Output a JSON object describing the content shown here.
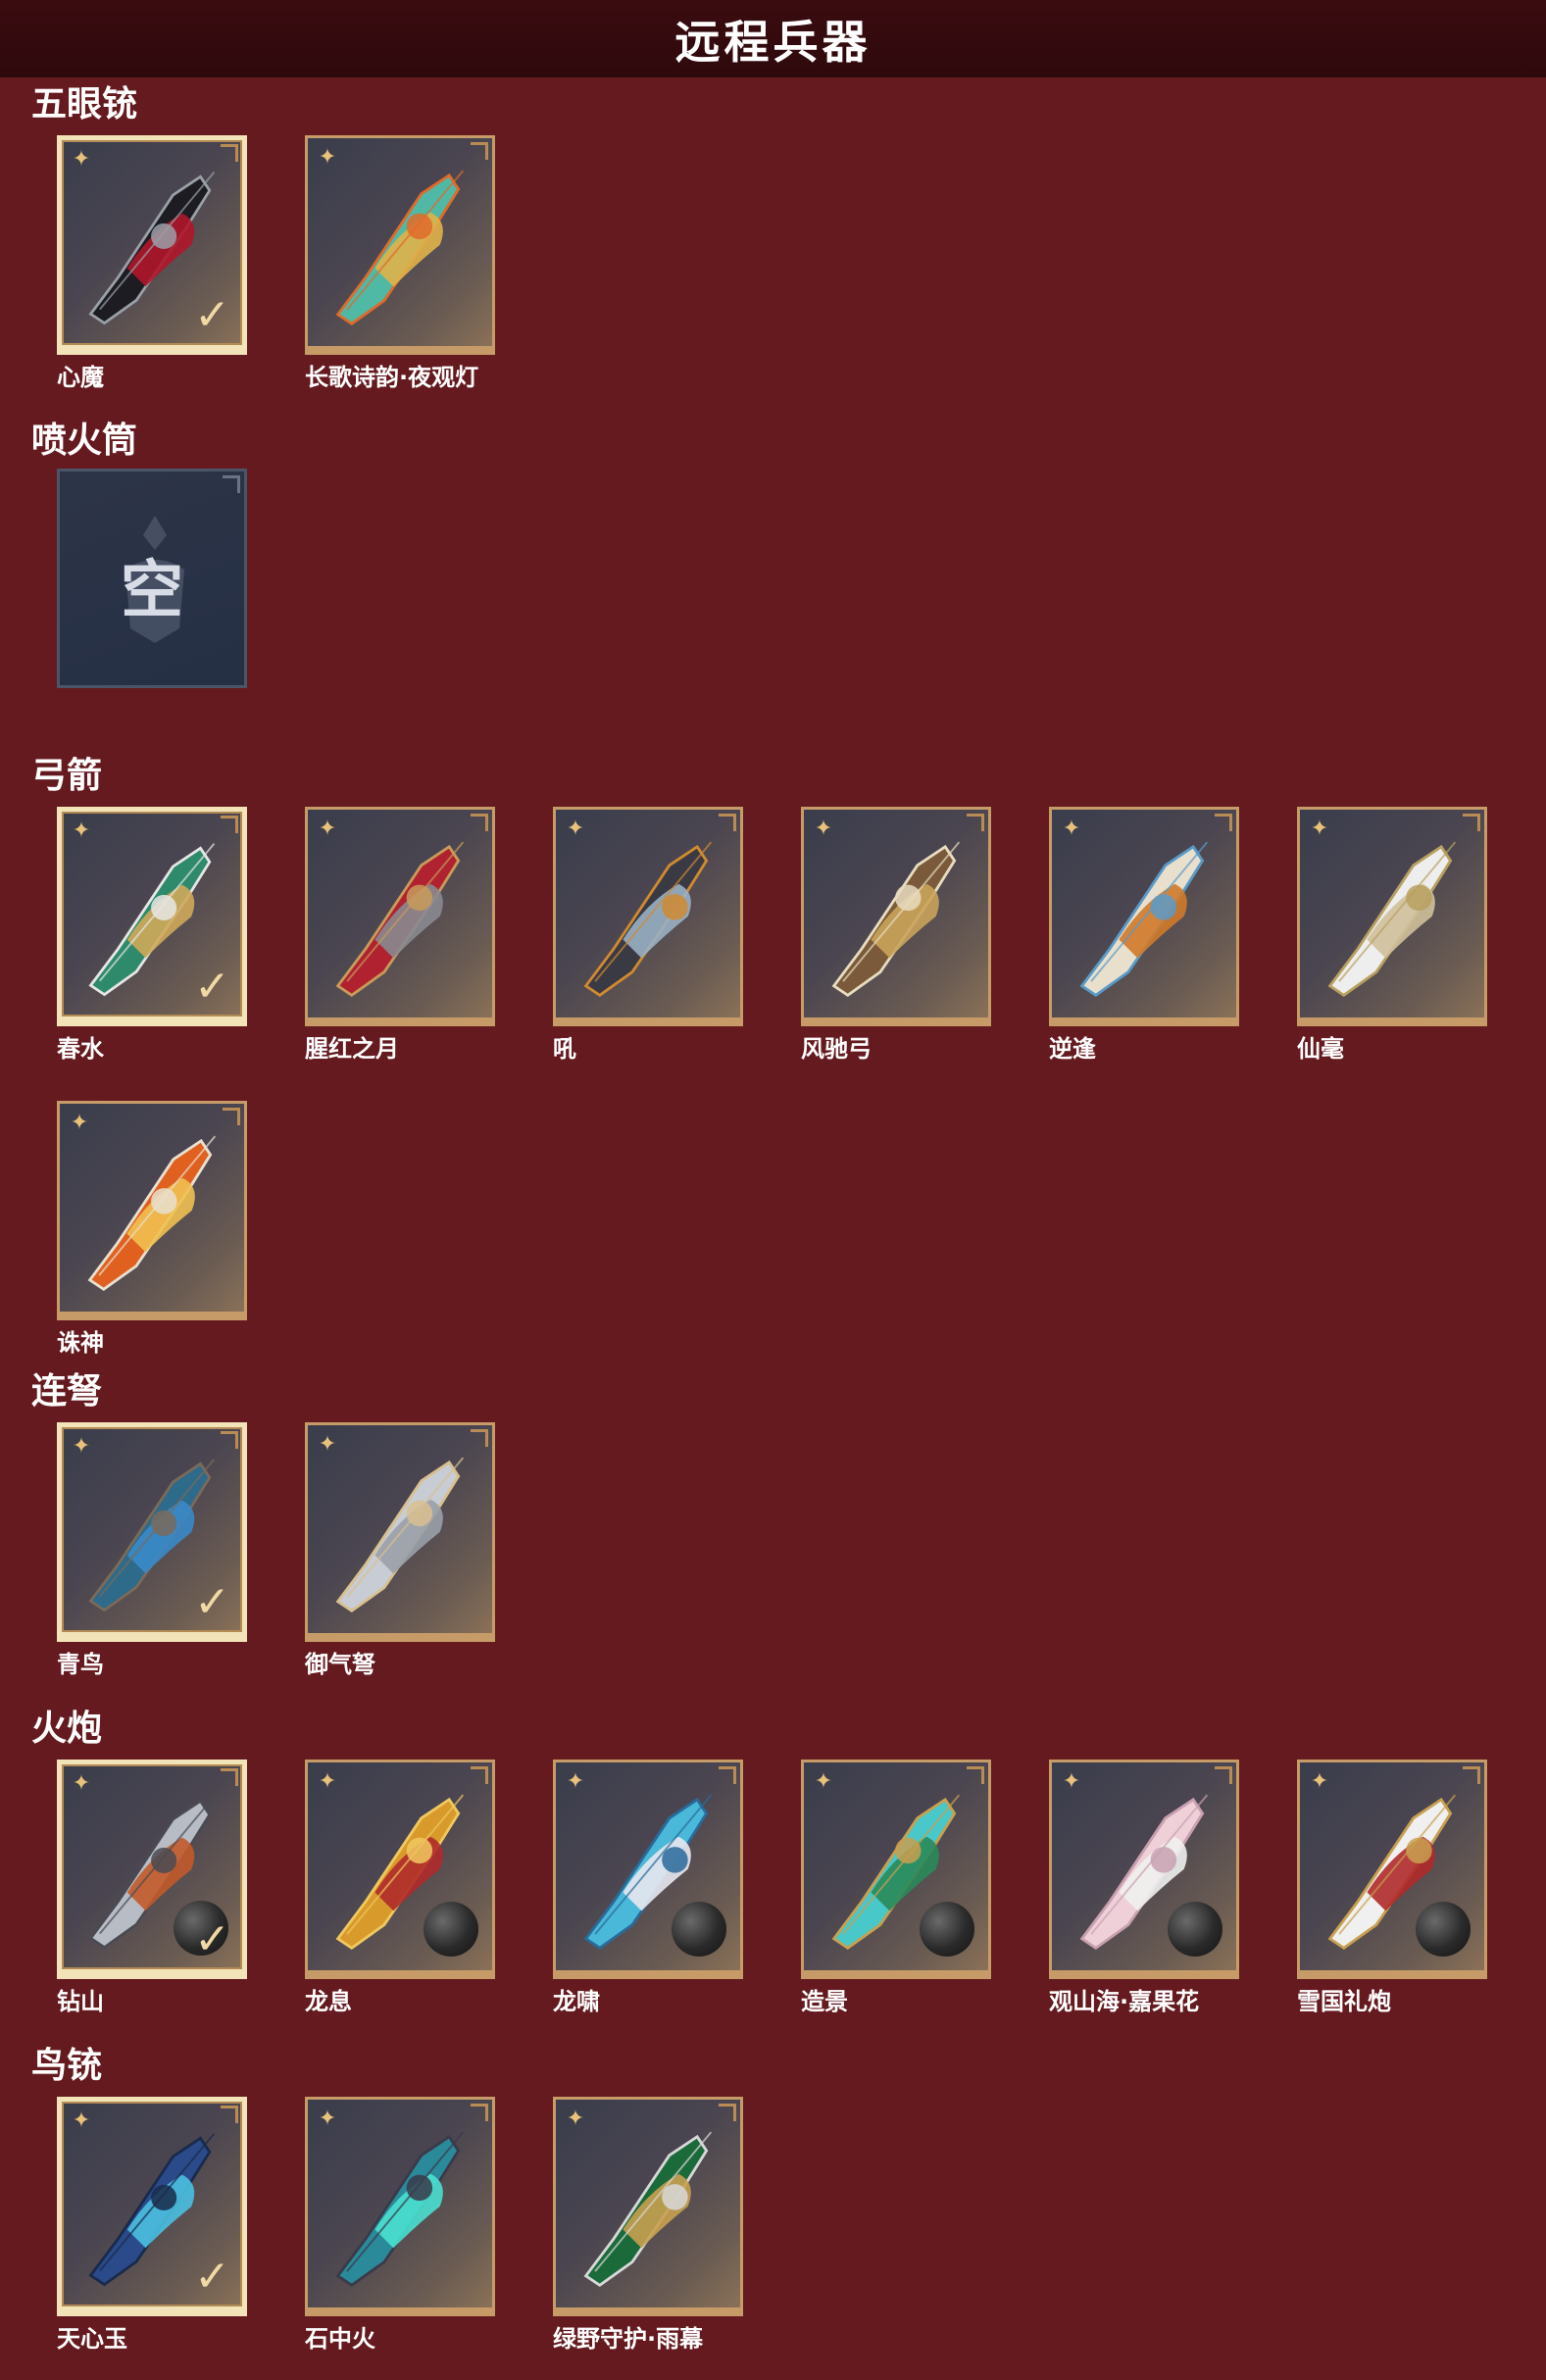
{
  "header": {
    "title": "远程兵器"
  },
  "sections": [
    {
      "title": "五眼铳",
      "items": [
        {
          "label": "心魔",
          "selected": true,
          "palette": [
            "#1c1c22",
            "#b0162a",
            "#9aa0a8"
          ]
        },
        {
          "label": "长歌诗韵·夜观灯",
          "selected": false,
          "palette": [
            "#4fb9a6",
            "#e0b24a",
            "#e06a2a"
          ]
        }
      ]
    },
    {
      "title": "喷火筒",
      "empty": true,
      "empty_text": "空"
    },
    {
      "title": "弓箭",
      "items": [
        {
          "label": "春水",
          "selected": true,
          "palette": [
            "#2e8a6a",
            "#cfa95a",
            "#e6e6e6"
          ]
        },
        {
          "label": "腥红之月",
          "selected": false,
          "palette": [
            "#b02230",
            "#8a8a90",
            "#c89b5a"
          ]
        },
        {
          "label": "吼",
          "selected": false,
          "palette": [
            "#3a3a44",
            "#9ab0c4",
            "#d08a30"
          ]
        },
        {
          "label": "风驰弓",
          "selected": false,
          "palette": [
            "#7a5a3a",
            "#c9a35a",
            "#e8dcc0"
          ]
        },
        {
          "label": "逆逢",
          "selected": false,
          "palette": [
            "#e8e0cc",
            "#d07a2a",
            "#5a9ac8"
          ]
        },
        {
          "label": "仙毫",
          "selected": false,
          "palette": [
            "#eeeeee",
            "#cfc09a",
            "#b8a060"
          ]
        },
        {
          "label": "诛神",
          "selected": false,
          "palette": [
            "#e06020",
            "#f0c050",
            "#e8e0d0"
          ]
        }
      ]
    },
    {
      "title": "连弩",
      "items": [
        {
          "label": "青鸟",
          "selected": true,
          "palette": [
            "#2e6a8a",
            "#3a8ac8",
            "#7a6a5a"
          ]
        },
        {
          "label": "御气弩",
          "selected": false,
          "palette": [
            "#c8ccd4",
            "#9aa0a8",
            "#d8c090"
          ]
        }
      ]
    },
    {
      "title": "火炮",
      "items": [
        {
          "label": "钻山",
          "selected": true,
          "palette": [
            "#b8bcc4",
            "#c25a2a",
            "#4a4a52"
          ],
          "ball": true
        },
        {
          "label": "龙息",
          "selected": false,
          "palette": [
            "#d89a2a",
            "#b02a2a",
            "#f0c860"
          ],
          "ball": true
        },
        {
          "label": "龙啸",
          "selected": false,
          "palette": [
            "#4ab8d8",
            "#e8e8f0",
            "#2a6a9a"
          ],
          "ball": true
        },
        {
          "label": "造景",
          "selected": false,
          "palette": [
            "#48c8c8",
            "#2a8a5a",
            "#c8a050"
          ],
          "ball": true
        },
        {
          "label": "观山海·嘉果花",
          "selected": false,
          "palette": [
            "#f0d0d8",
            "#f0f0f0",
            "#c8a0b0"
          ],
          "ball": true
        },
        {
          "label": "雪国礼炮",
          "selected": false,
          "palette": [
            "#f0f0f0",
            "#b02a2a",
            "#c8a050"
          ],
          "ball": true
        }
      ]
    },
    {
      "title": "鸟铳",
      "items": [
        {
          "label": "天心玉",
          "selected": true,
          "palette": [
            "#2a4a8a",
            "#4ac0e0",
            "#1a2a4a"
          ]
        },
        {
          "label": "石中火",
          "selected": false,
          "palette": [
            "#2a8a9a",
            "#4ae0d0",
            "#3a3a4a"
          ]
        },
        {
          "label": "绿野守护·雨幕",
          "selected": false,
          "palette": [
            "#1a6a3a",
            "#c8a050",
            "#d8d8d8"
          ]
        }
      ]
    }
  ]
}
